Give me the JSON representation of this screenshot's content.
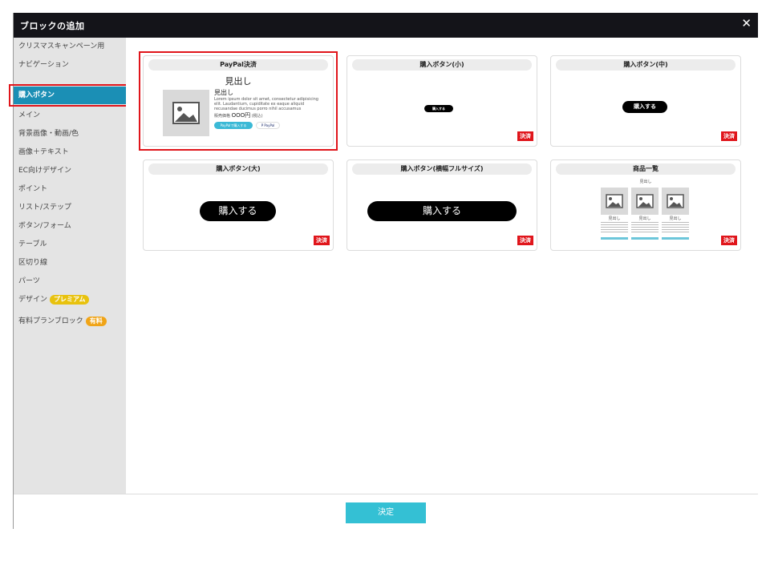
{
  "dialog": {
    "title": "ブロックの追加",
    "close_label": "✕"
  },
  "sidebar": {
    "items": [
      {
        "label": "クリスマスキャンペーン用"
      },
      {
        "label": "ナビゲーション"
      },
      {
        "label": "購入ボタン"
      },
      {
        "label": "メイン"
      },
      {
        "label": "背景画像・動画/色"
      },
      {
        "label": "画像＋テキスト"
      },
      {
        "label": "EC向けデザイン"
      },
      {
        "label": "ポイント"
      },
      {
        "label": "リスト/ステップ"
      },
      {
        "label": "ボタン/フォーム"
      },
      {
        "label": "テーブル"
      },
      {
        "label": "区切り線"
      },
      {
        "label": "パーツ"
      },
      {
        "label": "デザイン",
        "badge": "プレミアム"
      },
      {
        "label": "有料プランブロック",
        "badge": "有料"
      }
    ]
  },
  "cards": {
    "paypal": {
      "title": "PayPal決済",
      "heading": "見出し",
      "subheading": "見出し",
      "body": "Lorem ipsum dolor sit amet, consectetur adipisicing elit. Laudantium, cupiditate ex eaque aliquid recusandae ducimus porro nihil accusamus repellendus! Ipsam.",
      "price_label": "販売価格",
      "price": "OOO円",
      "tax": "(税込)",
      "paypal_button": "PayPalで購入する",
      "paypal_logo": "P PayPal"
    },
    "small": {
      "title": "購入ボタン(小)",
      "button": "購入する",
      "tag": "決済"
    },
    "medium": {
      "title": "購入ボタン(中)",
      "button": "購入する",
      "tag": "決済"
    },
    "large": {
      "title": "購入ボタン(大)",
      "button": "購入する",
      "tag": "決済"
    },
    "full": {
      "title": "購入ボタン(横幅フルサイズ)",
      "button": "購入する",
      "tag": "決済"
    },
    "list": {
      "title": "商品一覧",
      "heading": "見出し",
      "item_heading": "見出し",
      "tag": "決済"
    }
  },
  "footer": {
    "ok_label": "決定"
  }
}
